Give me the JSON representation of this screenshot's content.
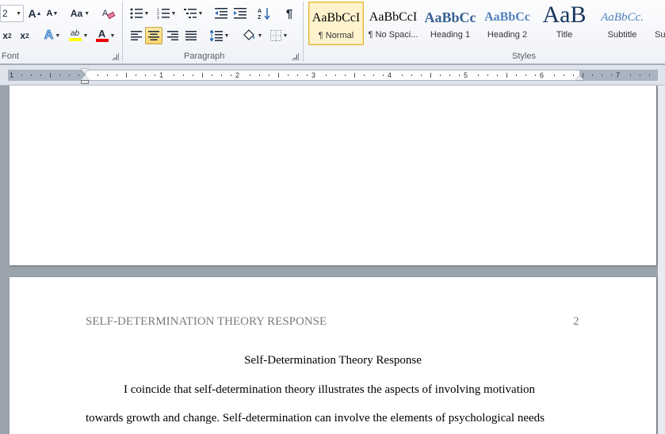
{
  "ribbon": {
    "font": {
      "label": "Font",
      "size_value": "2",
      "grow_label": "A",
      "shrink_label": "A",
      "case_label": "Aa",
      "sub_label": "x",
      "sub_mark": "2",
      "sup_label": "x",
      "sup_mark": "2",
      "effects_label": "A",
      "highlight_label": "ab",
      "color_label": "A"
    },
    "paragraph": {
      "label": "Paragraph",
      "pilcrow": "¶"
    },
    "styles": {
      "label": "Styles",
      "items": [
        {
          "sample": "AaBbCcI",
          "name": "¶ Normal"
        },
        {
          "sample": "AaBbCcI",
          "name": "¶ No Spaci..."
        },
        {
          "sample": "AaBbCc",
          "name": "Heading 1"
        },
        {
          "sample": "AaBbCc",
          "name": "Heading 2"
        },
        {
          "sample": "AaB",
          "name": "Title"
        },
        {
          "sample": "AaBbCc.",
          "name": "Subtitle"
        },
        {
          "sample": "",
          "name": "Su"
        }
      ]
    }
  },
  "ruler": {
    "numbers": [
      "1",
      "1",
      "2",
      "3",
      "4",
      "5",
      "6",
      "7"
    ]
  },
  "document": {
    "page2": {
      "running_head": "SELF-DETERMINATION THEORY RESPONSE",
      "page_number": "2",
      "title": "Self-Determination Theory Response",
      "line1": "I coincide that self-determination theory illustrates the aspects of involving motivation",
      "line2": "towards growth and change. Self-determination can involve the elements of psychological needs"
    }
  },
  "colors": {
    "accent_heading": "#365f91",
    "selected_style": "#fff3cd",
    "workspace": "#9ba3ad"
  }
}
